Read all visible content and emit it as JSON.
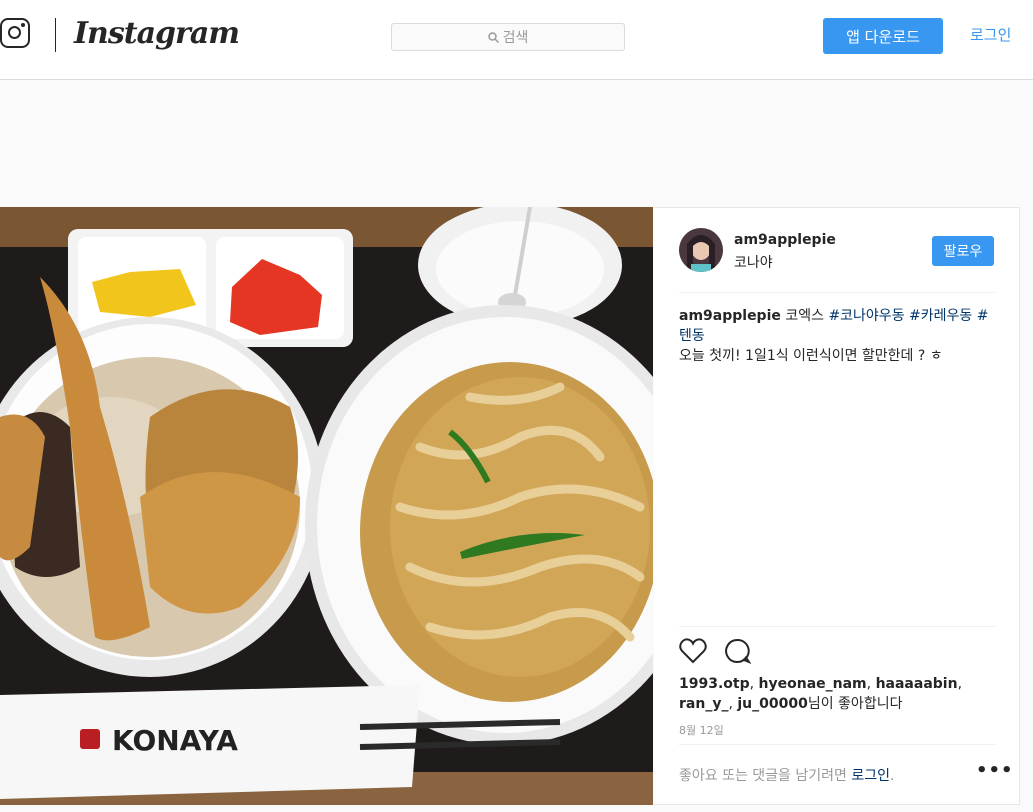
{
  "header": {
    "logo_text": "Instagram",
    "search_placeholder": "검색",
    "download_label": "앱 다운로드",
    "login_label": "로그인"
  },
  "post": {
    "photo": {
      "napkin_text": "KONAYA"
    },
    "username": "am9applepie",
    "location": "코나야",
    "follow_label": "팔로우",
    "caption": {
      "user": "am9applepie",
      "text_before": " 코엑스 ",
      "tags": [
        "#코나야우동",
        "#카레우동",
        "#텐동"
      ],
      "line2": "오늘 첫끼! 1일1식 이런식이면 할만한데 ? ㅎ"
    },
    "likes": {
      "names": [
        "1993.otp",
        "hyeonae_nam",
        "haaaaabin",
        "ran_y_",
        "ju_00000"
      ],
      "suffix": "님이 좋아합니다"
    },
    "date": "8월 12일",
    "comment_prompt": {
      "text": "좋아요 또는 댓글을 남기려면 ",
      "link": "로그인",
      "end": "."
    },
    "more_label": "•••"
  },
  "colors": {
    "accent": "#3897f0",
    "hashtag": "#003569",
    "border": "#dbdbdb"
  }
}
